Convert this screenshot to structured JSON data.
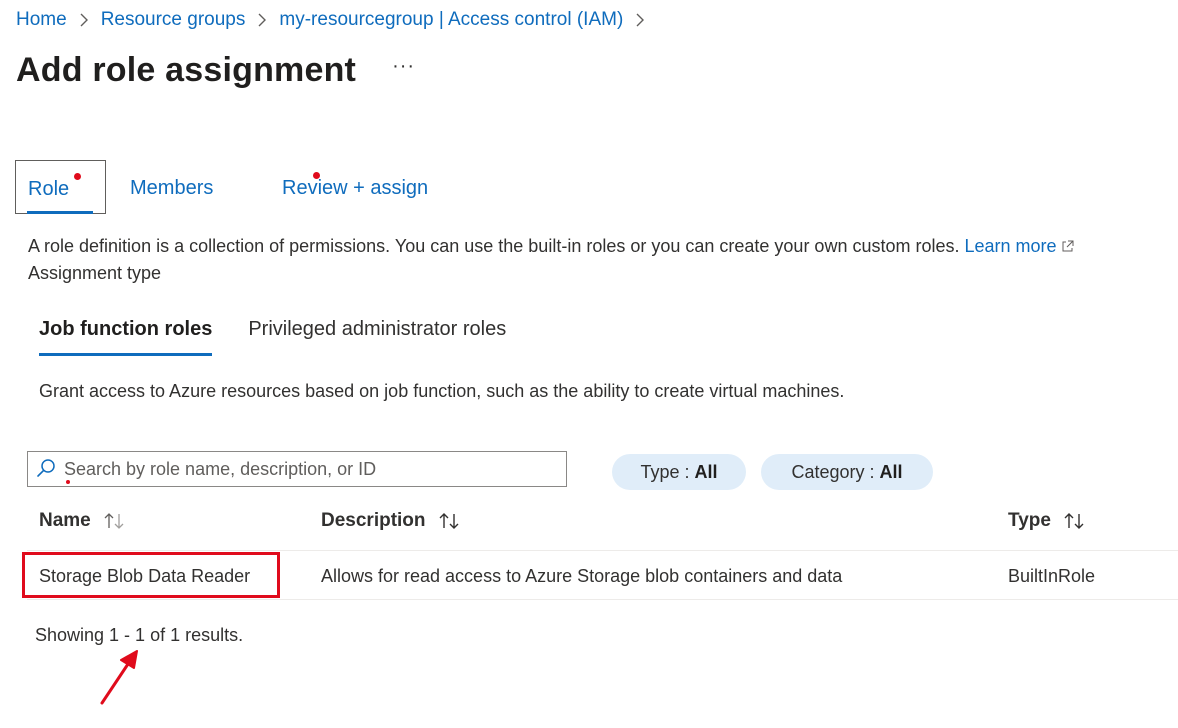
{
  "breadcrumb": {
    "items": [
      {
        "label": "Home"
      },
      {
        "label": "Resource groups"
      },
      {
        "label": "my-resourcegroup | Access control (IAM)"
      }
    ]
  },
  "header": {
    "title": "Add role assignment",
    "more_label": "···"
  },
  "wizard_tabs": [
    {
      "label": "Role",
      "selected": true,
      "required_indicator": true
    },
    {
      "label": "Members",
      "selected": false,
      "required_indicator": true
    },
    {
      "label": "Review + assign",
      "selected": false,
      "required_indicator": false
    }
  ],
  "description": {
    "text": "A role definition is a collection of permissions. You can use the built-in roles or you can create your own custom roles.",
    "learn_more": "Learn more"
  },
  "assignment_type_label": "Assignment type",
  "sub_tabs": [
    {
      "label": "Job function roles",
      "selected": true
    },
    {
      "label": "Privileged administrator roles",
      "selected": false
    }
  ],
  "grant_text": "Grant access to Azure resources based on job function, such as the ability to create virtual machines.",
  "search": {
    "placeholder": "Search by role name, description, or ID",
    "value": ""
  },
  "filters": {
    "type": {
      "label": "Type : ",
      "value": "All"
    },
    "category": {
      "label": "Category : ",
      "value": "All"
    }
  },
  "table": {
    "columns": [
      "Name",
      "Description",
      "Type"
    ],
    "rows": [
      {
        "name": "Storage Blob Data Reader",
        "description": "Allows for read access to Azure Storage blob containers and data",
        "type": "BuiltInRole"
      }
    ]
  },
  "results_text": "Showing 1 - 1 of 1 results.",
  "colors": {
    "link": "#0f6cbd",
    "required_dot": "#e00b1c",
    "highlight": "#e00b1c",
    "pill_bg": "#e0edf9"
  }
}
